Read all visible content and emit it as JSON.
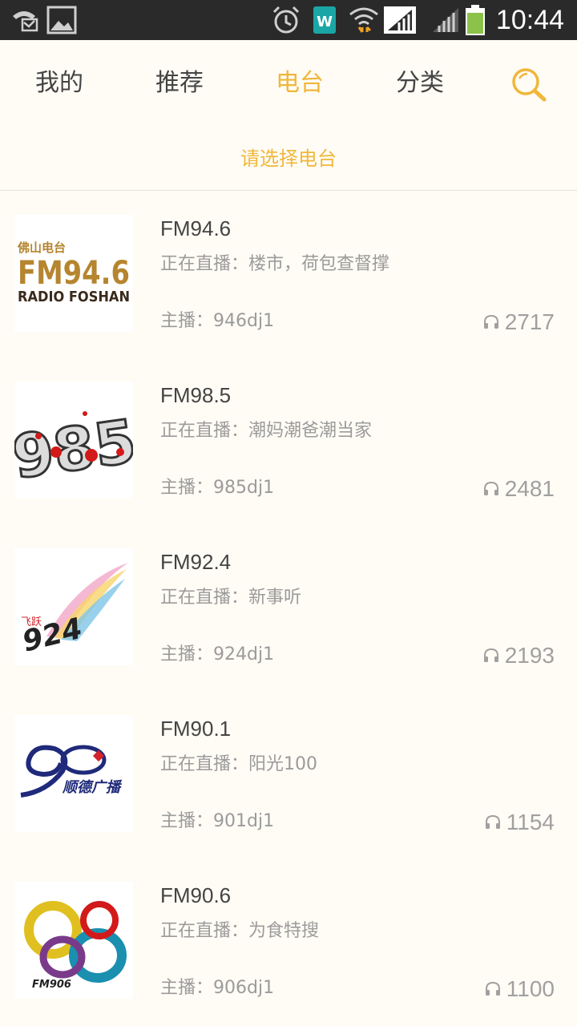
{
  "status_bar": {
    "time": "10:44",
    "icons": [
      "missed-call-icon",
      "image-icon",
      "alarm-icon",
      "app-w-icon",
      "wifi-icon",
      "signal-icon",
      "signal-icon-2",
      "battery-icon"
    ],
    "app_badge": "W"
  },
  "nav": {
    "tabs": [
      {
        "label": "我的",
        "active": false
      },
      {
        "label": "推荐",
        "active": false
      },
      {
        "label": "电台",
        "active": true
      },
      {
        "label": "分类",
        "active": false
      }
    ],
    "search_icon": "search-icon"
  },
  "subheader": {
    "label": "请选择电台"
  },
  "colors": {
    "accent": "#f0b73a",
    "background": "#fffcf5",
    "text_primary": "#444444",
    "text_secondary": "#9b9b9b"
  },
  "stations": [
    {
      "name": "FM94.6",
      "live": "正在直播：楼市，荷包查督撑",
      "host": "主播：946dj1",
      "listeners": "2717",
      "logo_text": {
        "top": "佛山电台",
        "main": "FM94.6",
        "bottom": "RADIO FOSHAN"
      }
    },
    {
      "name": "FM98.5",
      "live": "正在直播：潮妈潮爸潮当家",
      "host": "主播：985dj1",
      "listeners": "2481",
      "logo_text": {
        "main": "985"
      }
    },
    {
      "name": "FM92.4",
      "live": "正在直播：新事听",
      "host": "主播：924dj1",
      "listeners": "2193",
      "logo_text": {
        "top": "飞跃",
        "main": "924"
      }
    },
    {
      "name": "FM90.1",
      "live": "正在直播：阳光100",
      "host": "主播：901dj1",
      "listeners": "1154",
      "logo_text": {
        "main": "顺德广播"
      }
    },
    {
      "name": "FM90.6",
      "live": "正在直播：为食特搜",
      "host": "主播：906dj1",
      "listeners": "1100",
      "logo_text": {
        "main": "FM906"
      }
    }
  ]
}
